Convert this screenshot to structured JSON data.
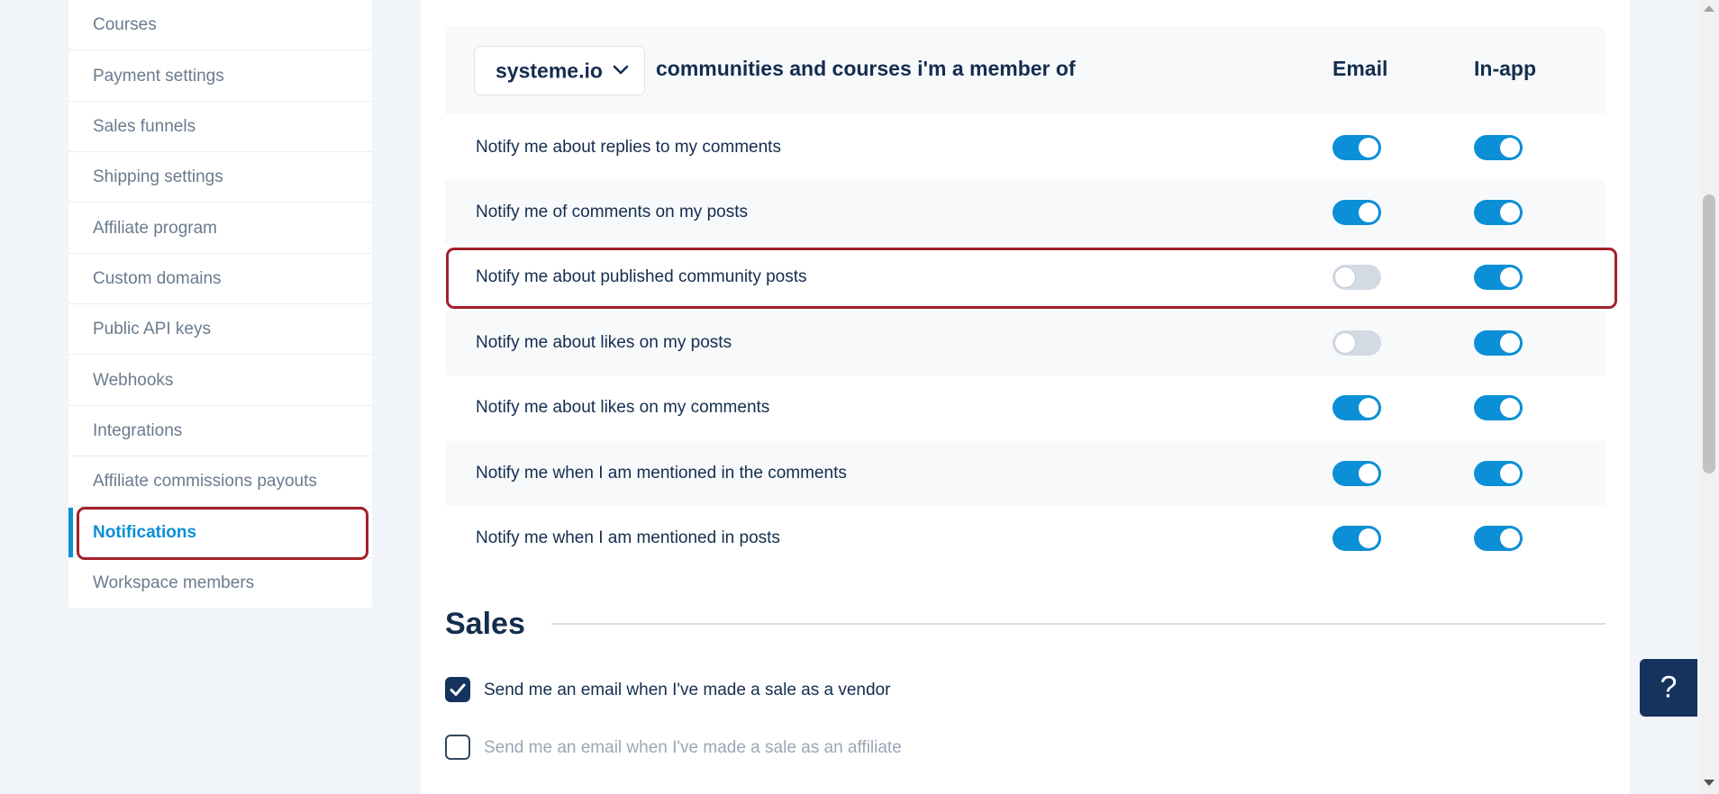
{
  "sidebar": {
    "items": [
      {
        "label": "Courses",
        "active": false
      },
      {
        "label": "Payment settings",
        "active": false
      },
      {
        "label": "Sales funnels",
        "active": false
      },
      {
        "label": "Shipping settings",
        "active": false
      },
      {
        "label": "Affiliate program",
        "active": false
      },
      {
        "label": "Custom domains",
        "active": false
      },
      {
        "label": "Public API keys",
        "active": false
      },
      {
        "label": "Webhooks",
        "active": false
      },
      {
        "label": "Integrations",
        "active": false
      },
      {
        "label": "Affiliate commissions payouts",
        "active": false
      },
      {
        "label": "Notifications",
        "active": true
      },
      {
        "label": "Workspace members",
        "active": false
      }
    ]
  },
  "community": {
    "workspace_select": "systeme.io",
    "heading": "communities and courses i'm a member of",
    "col_email": "Email",
    "col_inapp": "In-app",
    "rows": [
      {
        "label": "Notify me about replies to my comments",
        "email": true,
        "inapp": true
      },
      {
        "label": "Notify me of comments on my posts",
        "email": true,
        "inapp": true
      },
      {
        "label": "Notify me about published community posts",
        "email": false,
        "inapp": true
      },
      {
        "label": "Notify me about likes on my posts",
        "email": false,
        "inapp": true
      },
      {
        "label": "Notify me about likes on my comments",
        "email": true,
        "inapp": true
      },
      {
        "label": "Notify me when I am mentioned in the comments",
        "email": true,
        "inapp": true
      },
      {
        "label": "Notify me when I am mentioned in posts",
        "email": true,
        "inapp": true
      }
    ]
  },
  "sales": {
    "title": "Sales",
    "options": [
      {
        "label": "Send me an email when I've made a sale as a vendor",
        "checked": true
      },
      {
        "label": "Send me an email when I've made a sale as an affiliate",
        "checked": false
      }
    ]
  },
  "help_button": "?",
  "colors": {
    "accent": "#0b8fd6",
    "navy": "#15335c",
    "highlight": "#a3212a"
  }
}
